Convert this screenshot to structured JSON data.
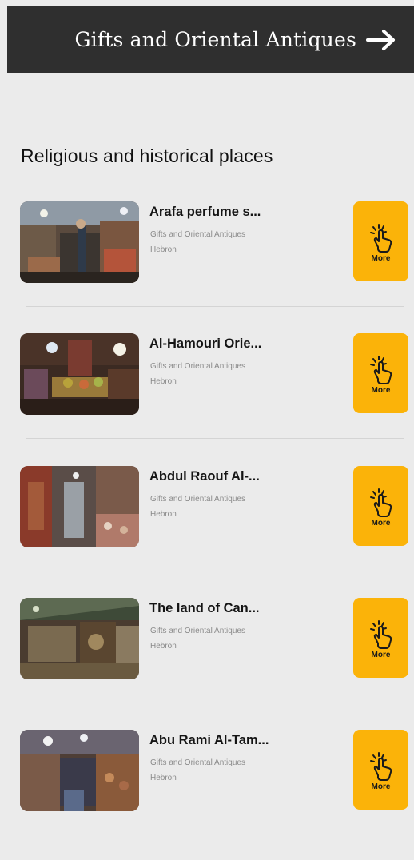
{
  "header": {
    "title": "Gifts and Oriental Antiques",
    "arrow_icon": "arrow-right-icon"
  },
  "section": {
    "title": "Religious and historical places"
  },
  "colors": {
    "header_bg": "#2f2f2f",
    "page_bg": "#ebebeb",
    "more_button": "#fbb309"
  },
  "places": [
    {
      "title": "Arafa perfume s...",
      "category": "Gifts and Oriental Antiques",
      "city": "Hebron",
      "more_label": "More",
      "more_icon": "hand-tap-icon"
    },
    {
      "title": "Al-Hamouri Orie...",
      "category": "Gifts and Oriental Antiques",
      "city": "Hebron",
      "more_label": "More",
      "more_icon": "hand-tap-icon"
    },
    {
      "title": "Abdul Raouf Al-...",
      "category": "Gifts and Oriental Antiques",
      "city": "Hebron",
      "more_label": "More",
      "more_icon": "hand-tap-icon"
    },
    {
      "title": "The land of Can...",
      "category": "Gifts and Oriental Antiques",
      "city": "Hebron",
      "more_label": "More",
      "more_icon": "hand-tap-icon"
    },
    {
      "title": "Abu Rami Al-Tam...",
      "category": "Gifts and Oriental Antiques",
      "city": "Hebron",
      "more_label": "More",
      "more_icon": "hand-tap-icon"
    }
  ]
}
